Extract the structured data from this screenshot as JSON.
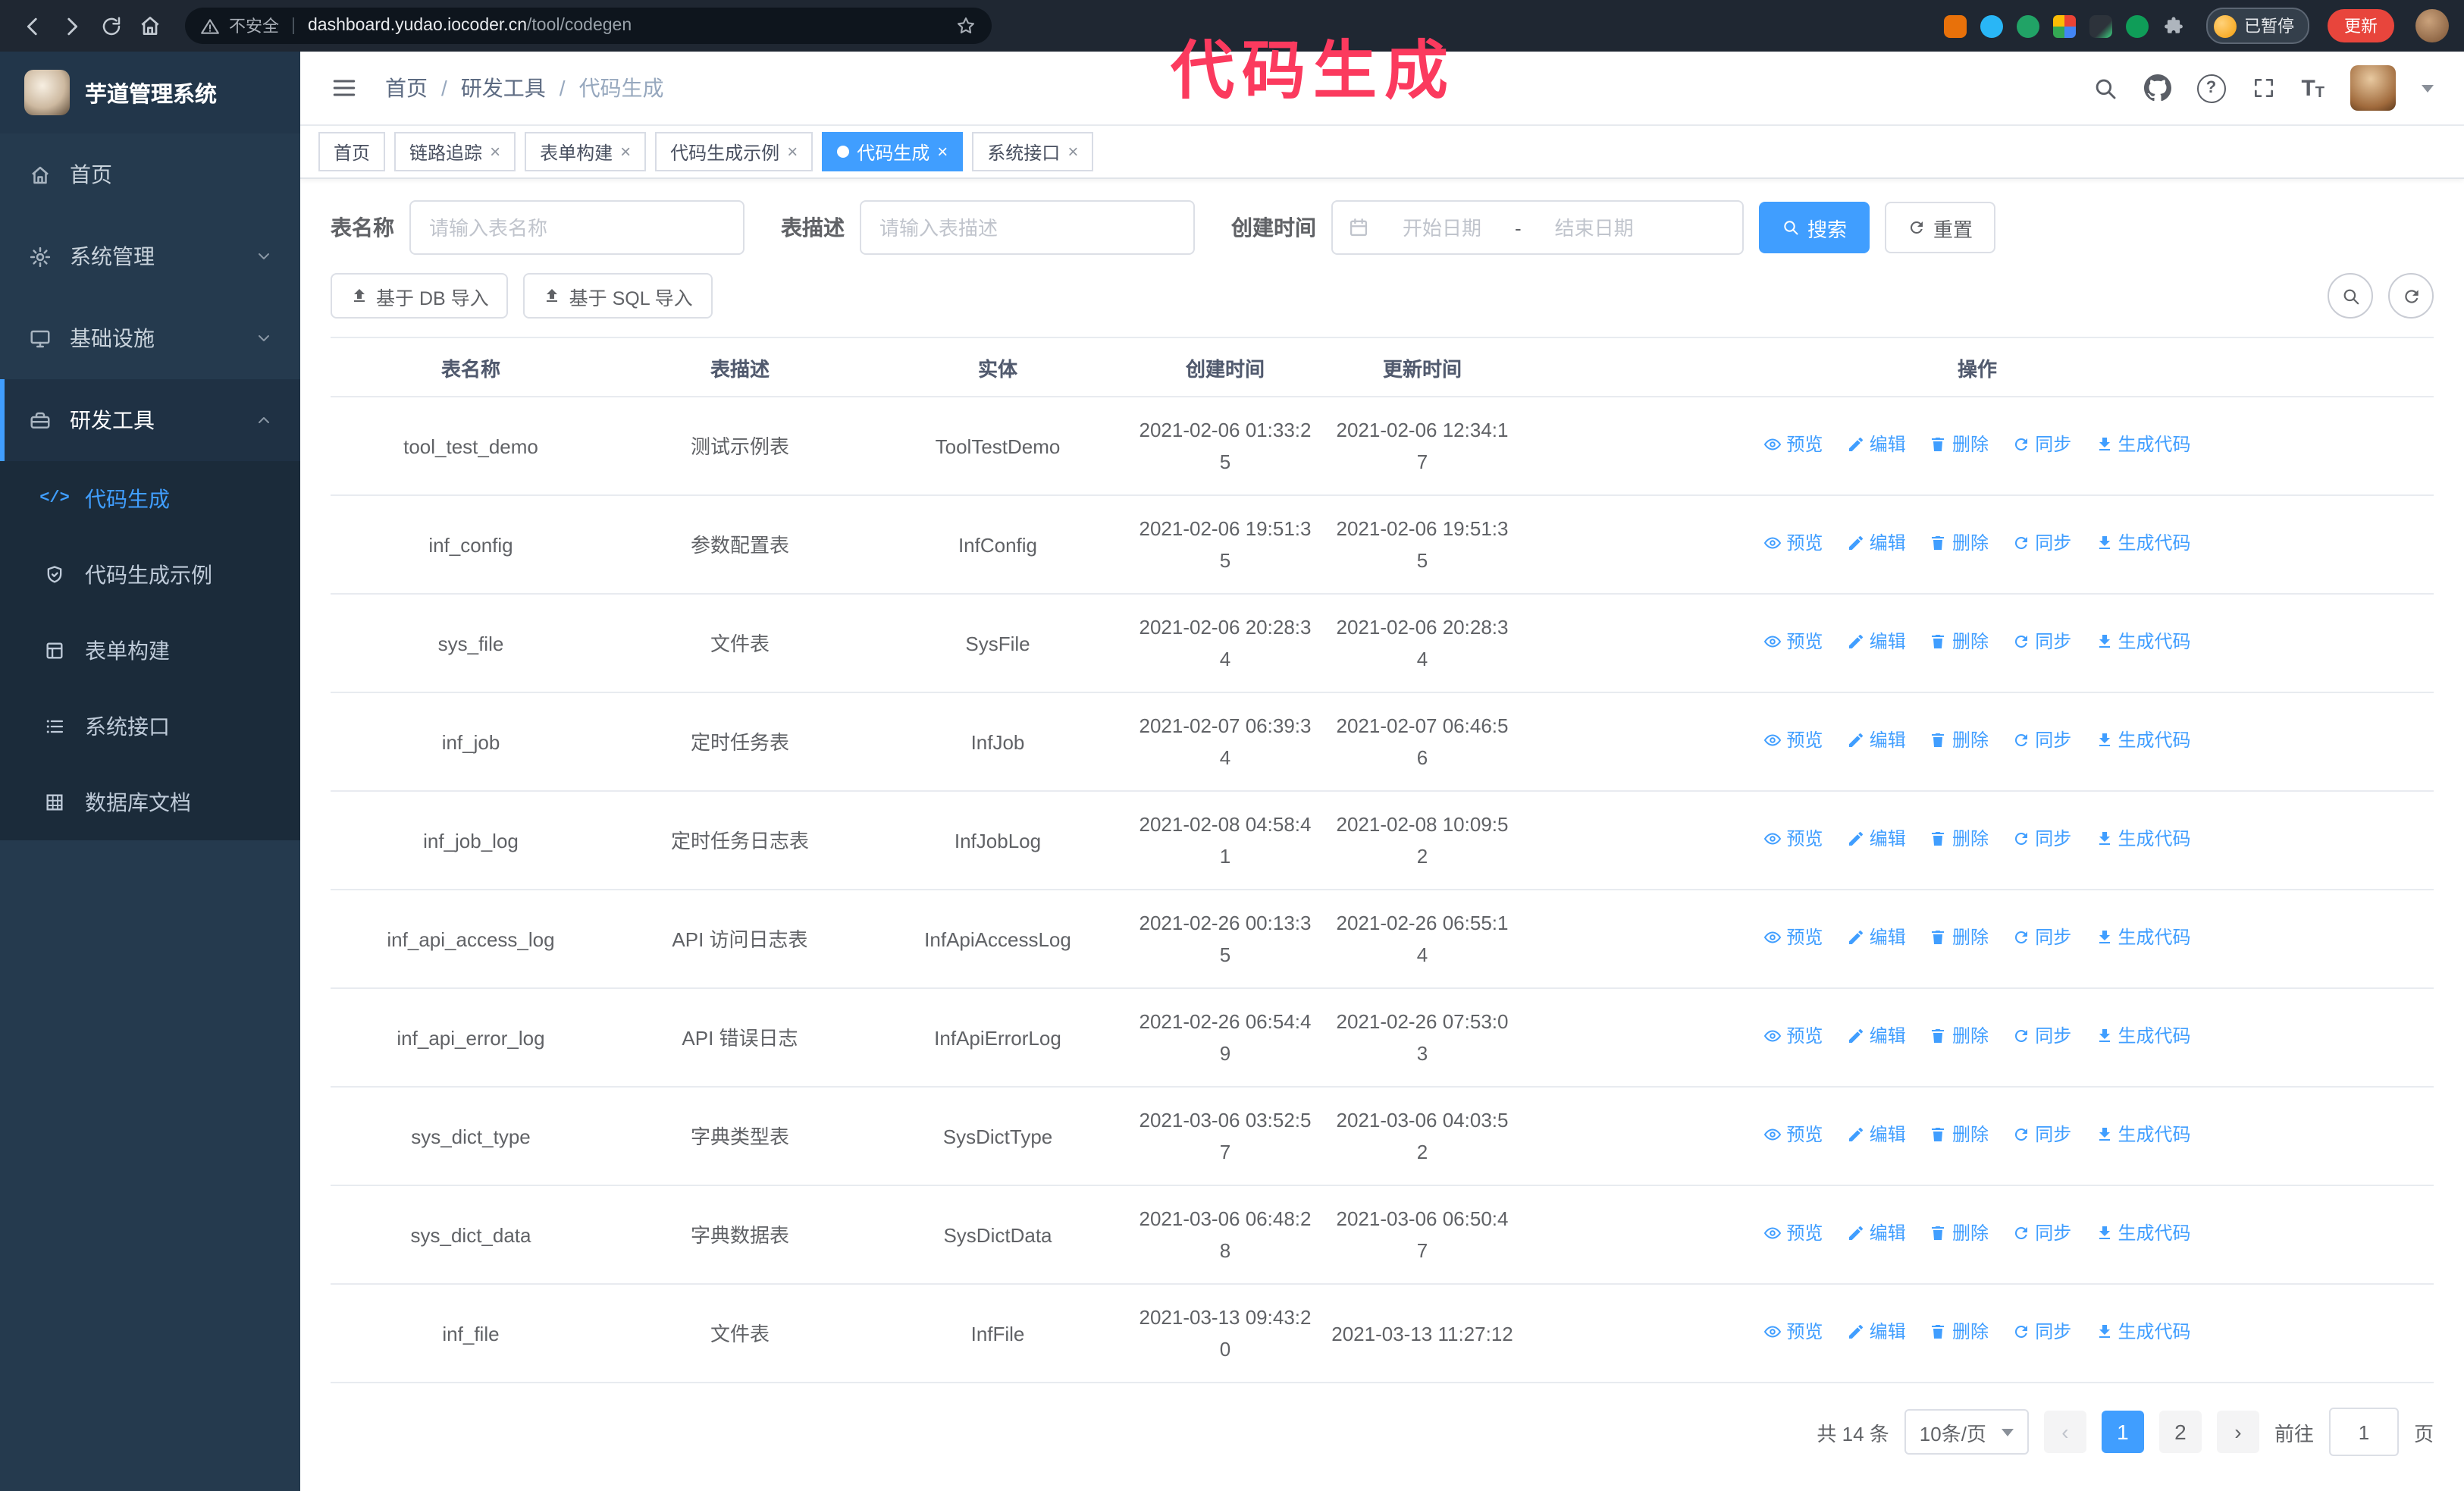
{
  "colors": {
    "accent": "#409eff",
    "annotation": "#fb3a5e",
    "chrome_bg": "#1f2732",
    "sidebar_bg": "#253a4e",
    "update_button": "#e8453c"
  },
  "annotation": {
    "text": "代码生成"
  },
  "browser": {
    "security_label": "不安全",
    "url_divider": "|",
    "url_host": "dashboard.yudao.iocoder.cn",
    "url_path": "/tool/codegen",
    "paused_badge": "已暂停",
    "update_button": "更新"
  },
  "ui": {
    "close_glyph": "×",
    "help_glyph": "?",
    "font_size_glyph_big": "T",
    "font_size_glyph_small": "T"
  },
  "sidebar": {
    "logo_title": "芋道管理系统",
    "code_glyph": "</>",
    "items": [
      {
        "label": "首页"
      },
      {
        "label": "系统管理"
      },
      {
        "label": "基础设施"
      },
      {
        "label": "研发工具",
        "expanded": true
      }
    ],
    "subitems": [
      {
        "label": "代码生成",
        "active": true
      },
      {
        "label": "代码生成示例"
      },
      {
        "label": "表单构建"
      },
      {
        "label": "系统接口"
      },
      {
        "label": "数据库文档"
      }
    ]
  },
  "header": {
    "breadcrumb": [
      "首页",
      "研发工具",
      "代码生成"
    ],
    "breadcrumb_separator": "/"
  },
  "tabs": [
    {
      "label": "首页"
    },
    {
      "label": "链路追踪"
    },
    {
      "label": "表单构建"
    },
    {
      "label": "代码生成示例"
    },
    {
      "label": "代码生成",
      "active": true
    },
    {
      "label": "系统接口"
    }
  ],
  "filters": {
    "table_name_label": "表名称",
    "table_name_placeholder": "请输入表名称",
    "table_desc_label": "表描述",
    "table_desc_placeholder": "请输入表描述",
    "create_time_label": "创建时间",
    "date_start_placeholder": "开始日期",
    "date_separator": "-",
    "date_end_placeholder": "结束日期",
    "search_button": "搜索",
    "reset_button": "重置"
  },
  "toolbar": {
    "import_db_button": "基于 DB 导入",
    "import_sql_button": "基于 SQL 导入"
  },
  "table": {
    "columns": [
      "表名称",
      "表描述",
      "实体",
      "创建时间",
      "更新时间",
      "操作"
    ],
    "actions": [
      "预览",
      "编辑",
      "删除",
      "同步",
      "生成代码"
    ],
    "rows": [
      {
        "name": "tool_test_demo",
        "desc": "测试示例表",
        "entity": "ToolTestDemo",
        "created": "2021-02-06 01:33:25",
        "updated": "2021-02-06 12:34:17"
      },
      {
        "name": "inf_config",
        "desc": "参数配置表",
        "entity": "InfConfig",
        "created": "2021-02-06 19:51:35",
        "updated": "2021-02-06 19:51:35"
      },
      {
        "name": "sys_file",
        "desc": "文件表",
        "entity": "SysFile",
        "created": "2021-02-06 20:28:34",
        "updated": "2021-02-06 20:28:34"
      },
      {
        "name": "inf_job",
        "desc": "定时任务表",
        "entity": "InfJob",
        "created": "2021-02-07 06:39:34",
        "updated": "2021-02-07 06:46:56"
      },
      {
        "name": "inf_job_log",
        "desc": "定时任务日志表",
        "entity": "InfJobLog",
        "created": "2021-02-08 04:58:41",
        "updated": "2021-02-08 10:09:52"
      },
      {
        "name": "inf_api_access_log",
        "desc": "API 访问日志表",
        "entity": "InfApiAccessLog",
        "created": "2021-02-26 00:13:35",
        "updated": "2021-02-26 06:55:14"
      },
      {
        "name": "inf_api_error_log",
        "desc": "API 错误日志",
        "entity": "InfApiErrorLog",
        "created": "2021-02-26 06:54:49",
        "updated": "2021-02-26 07:53:03"
      },
      {
        "name": "sys_dict_type",
        "desc": "字典类型表",
        "entity": "SysDictType",
        "created": "2021-03-06 03:52:57",
        "updated": "2021-03-06 04:03:52"
      },
      {
        "name": "sys_dict_data",
        "desc": "字典数据表",
        "entity": "SysDictData",
        "created": "2021-03-06 06:48:28",
        "updated": "2021-03-06 06:50:47"
      },
      {
        "name": "inf_file",
        "desc": "文件表",
        "entity": "InfFile",
        "created": "2021-03-13 09:43:20",
        "updated": "2021-03-13 11:27:12"
      }
    ]
  },
  "pagination": {
    "total": "共 14 条",
    "page_size": "10条/页",
    "prev": "‹",
    "pages": [
      "1",
      "2"
    ],
    "active_page": "1",
    "next": "›",
    "goto_label": "前往",
    "goto_value": "1",
    "goto_suffix": "页"
  }
}
